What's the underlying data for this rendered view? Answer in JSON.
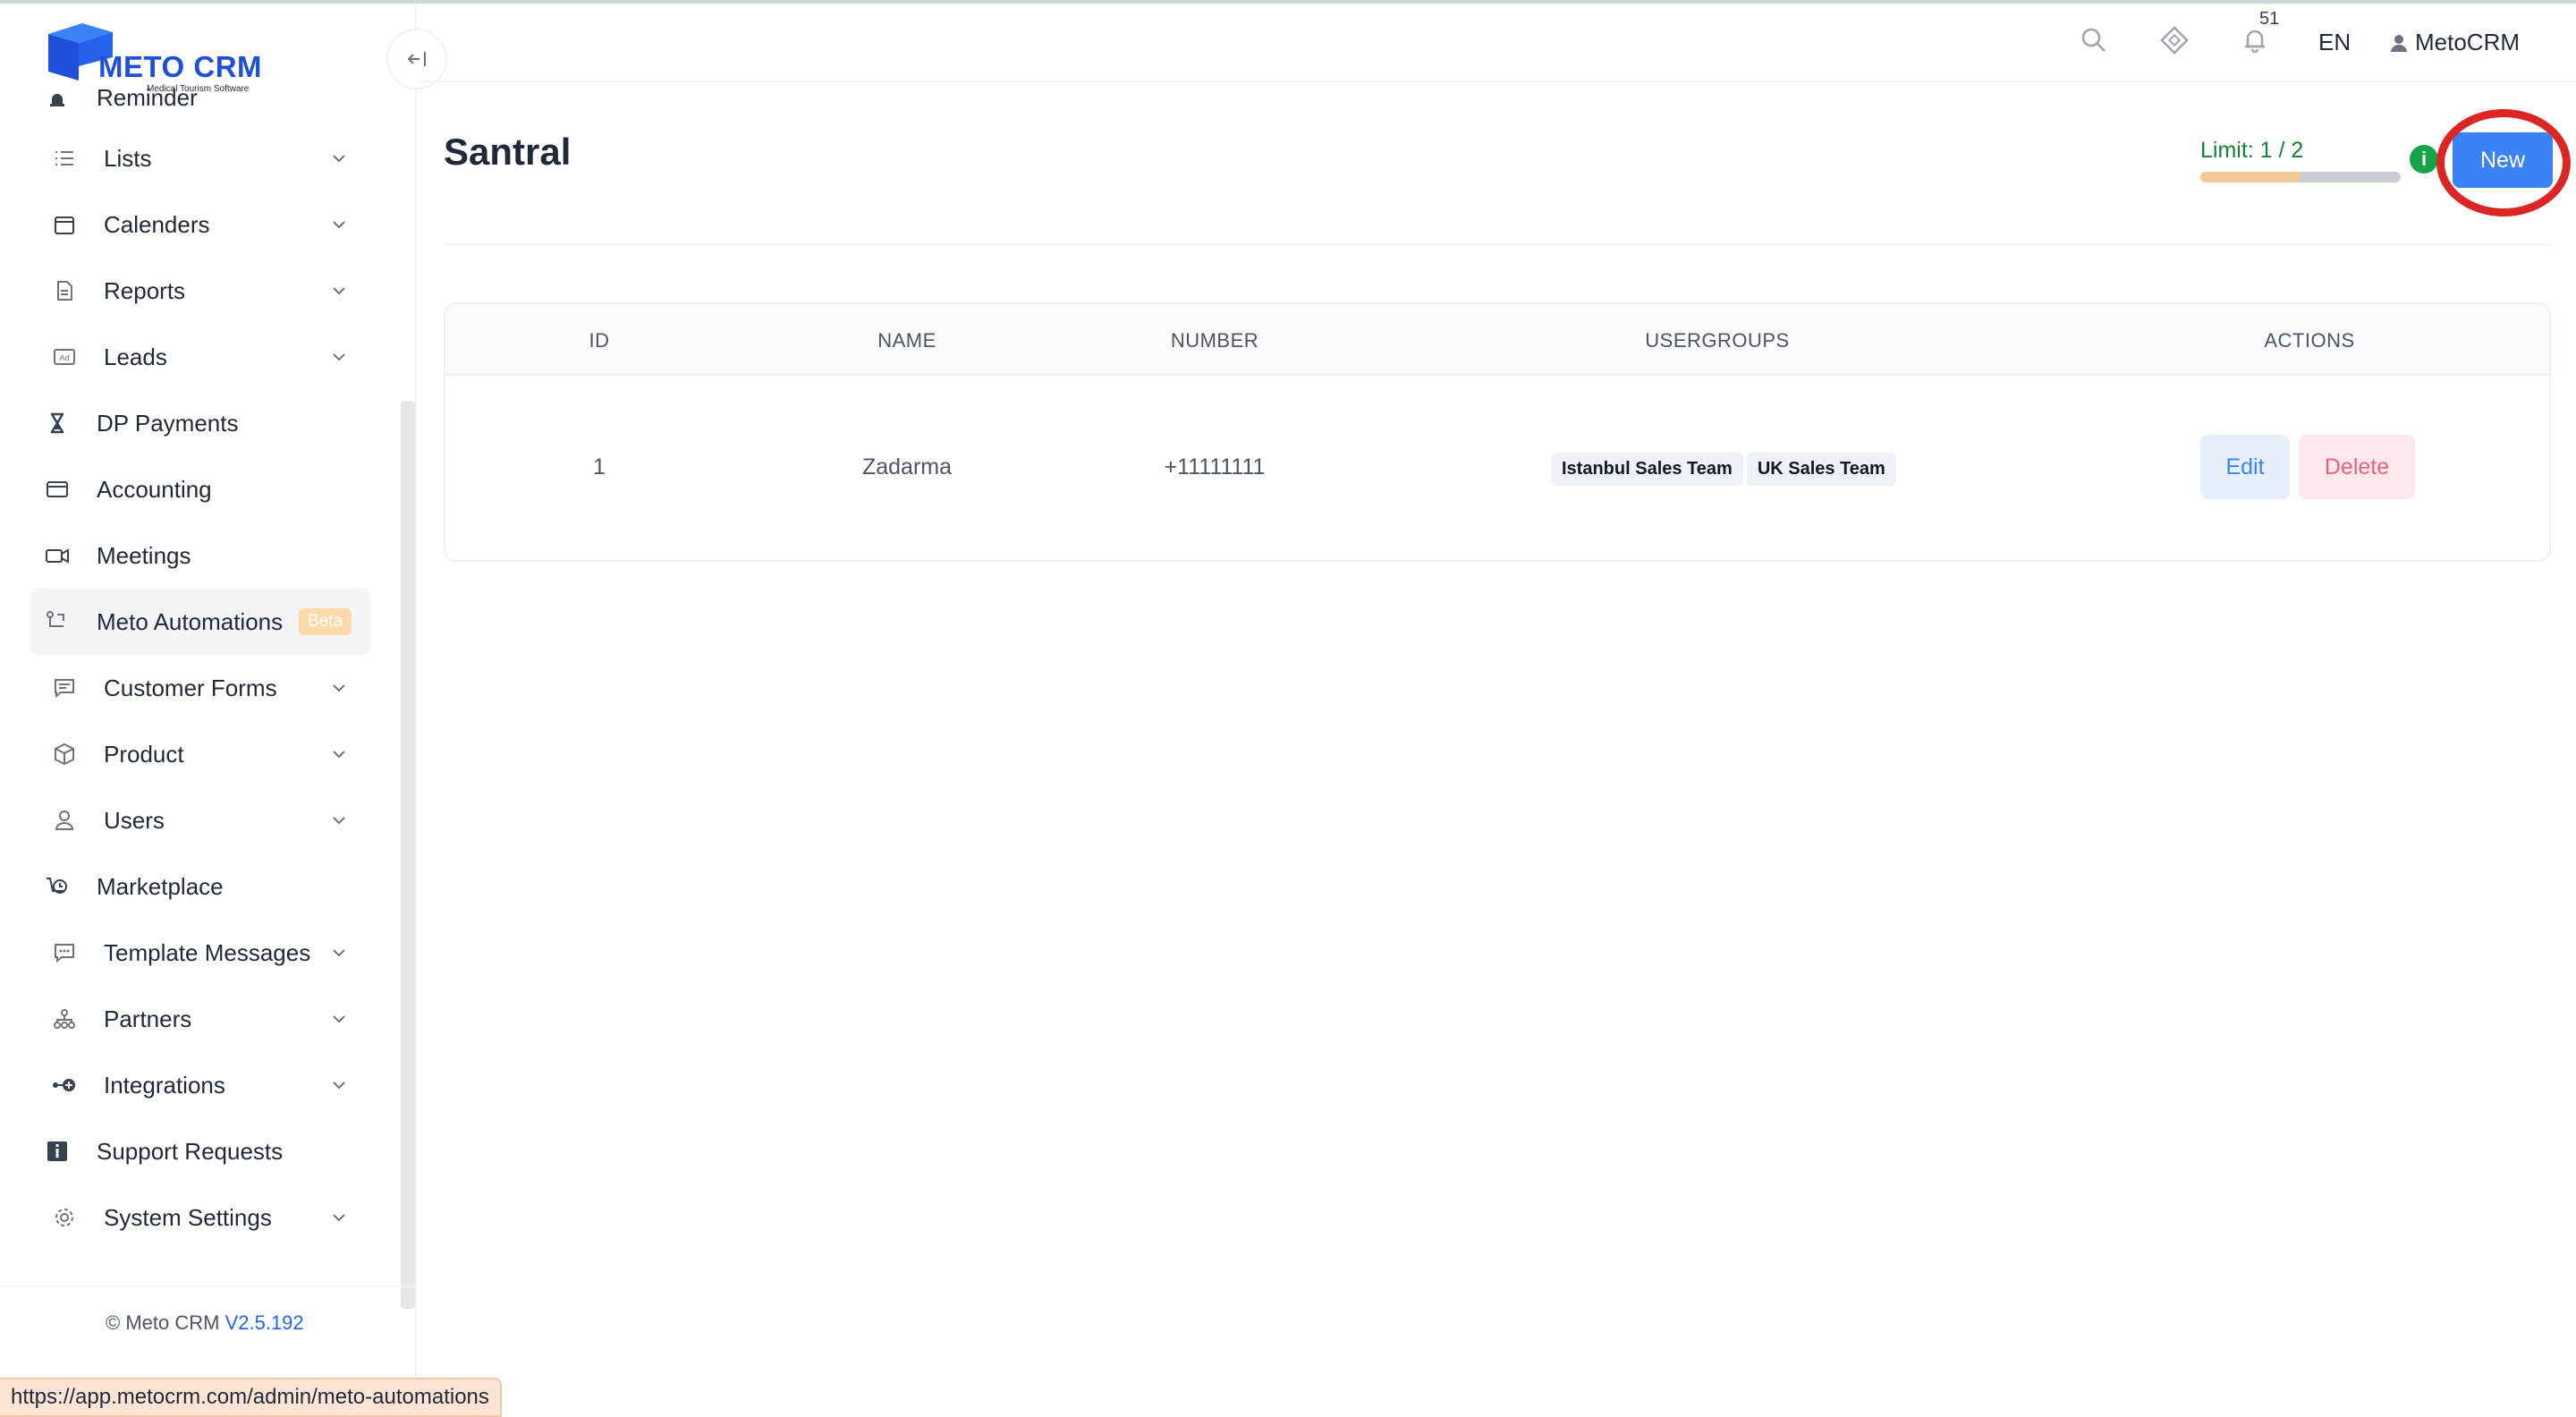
{
  "brand": {
    "name": "METO CRM",
    "tagline": "Medical Tourism Software",
    "primary_color": "#1e4fd8"
  },
  "sidebar": {
    "partial_item": {
      "label": "Reminder",
      "icon": "bell-icon"
    },
    "items": [
      {
        "label": "Lists",
        "icon": "list-icon",
        "has_submenu": true
      },
      {
        "label": "Calenders",
        "icon": "calendar-icon",
        "has_submenu": true
      },
      {
        "label": "Reports",
        "icon": "report-icon",
        "has_submenu": true
      },
      {
        "label": "Leads",
        "icon": "ad-icon",
        "has_submenu": true
      },
      {
        "label": "DP Payments",
        "icon": "hourglass-icon",
        "has_submenu": false
      },
      {
        "label": "Accounting",
        "icon": "card-icon",
        "has_submenu": false
      },
      {
        "label": "Meetings",
        "icon": "video-icon",
        "has_submenu": false
      },
      {
        "label": "Meto Automations",
        "icon": "flow-icon",
        "has_submenu": false,
        "badge": "Beta",
        "active": true
      },
      {
        "label": "Customer Forms",
        "icon": "form-icon",
        "has_submenu": true
      },
      {
        "label": "Product",
        "icon": "box-icon",
        "has_submenu": true
      },
      {
        "label": "Users",
        "icon": "user-icon",
        "has_submenu": true
      },
      {
        "label": "Marketplace",
        "icon": "marketplace-icon",
        "has_submenu": false
      },
      {
        "label": "Template Messages",
        "icon": "message-icon",
        "has_submenu": true
      },
      {
        "label": "Partners",
        "icon": "partners-icon",
        "has_submenu": true
      },
      {
        "label": "Integrations",
        "icon": "plug-icon",
        "has_submenu": true
      },
      {
        "label": "Support Requests",
        "icon": "info-square-icon",
        "has_submenu": false
      },
      {
        "label": "System Settings",
        "icon": "gear-icon",
        "has_submenu": true
      }
    ],
    "footer": {
      "copyright": "© Meto CRM",
      "version": "V2.5.192"
    }
  },
  "header": {
    "notification_count": "51",
    "language": "EN",
    "username": "MetoCRM"
  },
  "page": {
    "title": "Santral",
    "limit_label": "Limit: 1 / 2",
    "limit_used": 1,
    "limit_total": 2,
    "new_button": "New"
  },
  "table": {
    "columns": [
      "ID",
      "NAME",
      "NUMBER",
      "USERGROUPS",
      "ACTIONS"
    ],
    "rows": [
      {
        "id": "1",
        "name": "Zadarma",
        "number": "+11111111",
        "usergroups": [
          "Istanbul Sales Team",
          "UK Sales Team"
        ],
        "actions": {
          "edit": "Edit",
          "delete": "Delete"
        }
      }
    ]
  },
  "status_bar": {
    "url": "https://app.metocrm.com/admin/meto-automations"
  }
}
